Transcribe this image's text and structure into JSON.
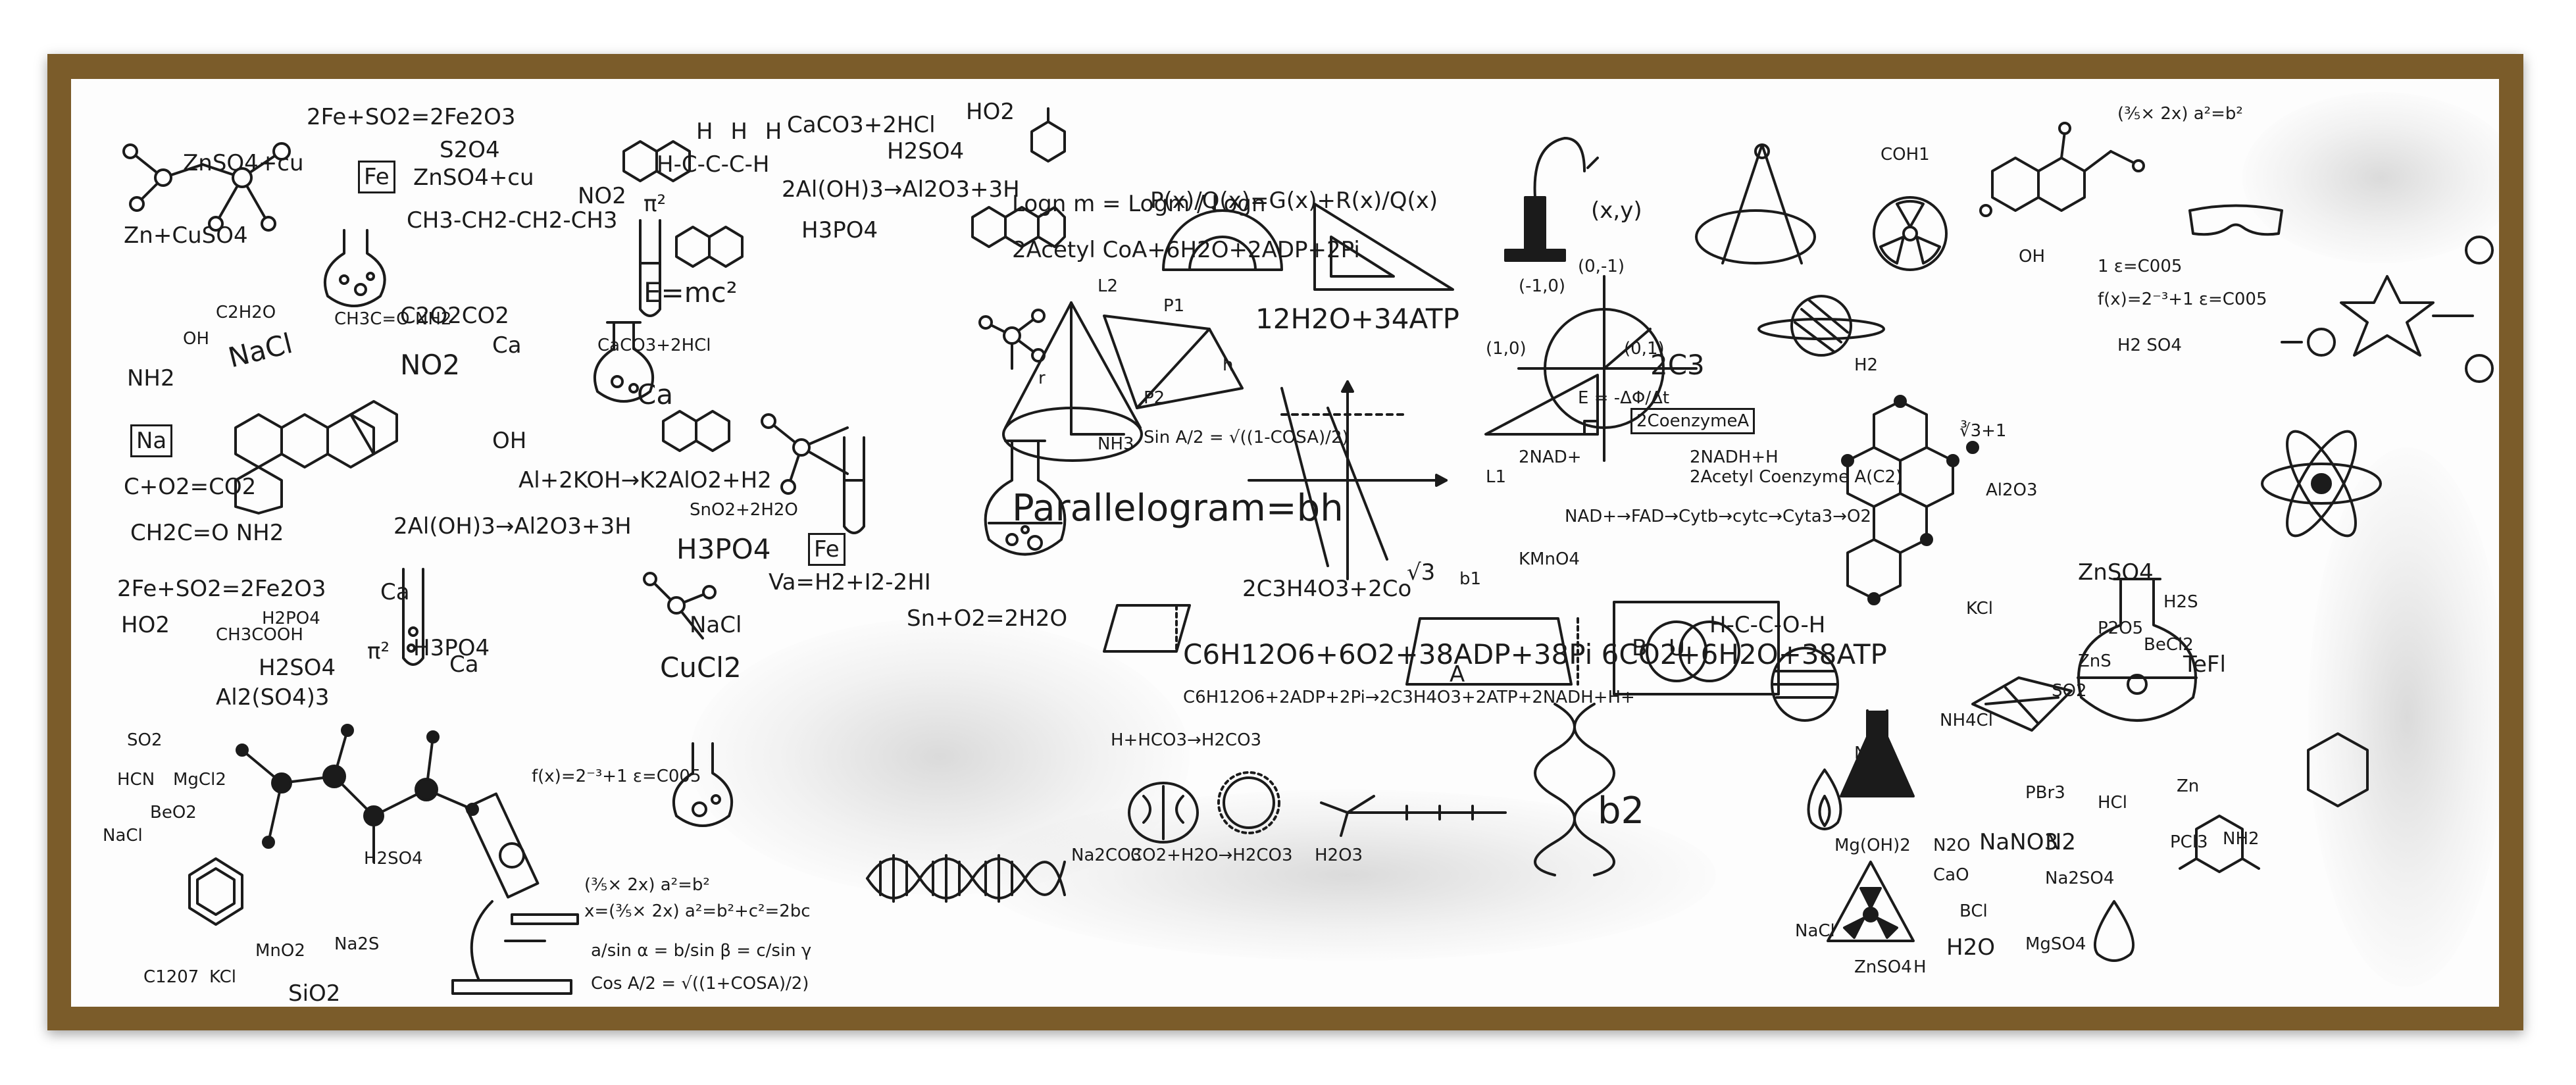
{
  "colors": {
    "frame": "#7b5c2a",
    "board": "#fdfdfd",
    "ink": "#1b1b1b"
  },
  "icons": [
    "molecule-icon",
    "flask-icon",
    "test-tube-icon",
    "microscope-icon",
    "dna-icon",
    "atom-icon",
    "radiation-icon",
    "brain-icon",
    "neuron-icon",
    "cone-icon",
    "protractor-icon",
    "set-square-icon",
    "compass-icon",
    "goggles-icon",
    "burner-icon",
    "fire-icon",
    "venn-diagram-icon",
    "planet-icon",
    "benzene-icon"
  ],
  "notes": [
    "ZnSO4+cu",
    "Zn+CuSO4",
    "2Fe+SO2=2Fe2O3",
    "S2O4",
    "Fe",
    "ZnSO4+cu",
    "NO2",
    "π²",
    "H H H",
    "H-C-C-C-H",
    "CaCO3+2HCl",
    "2Al(OH)3→Al2O3+3H",
    "H2SO4",
    "HO2",
    "H3PO4",
    "CH3-CH2-CH2-CH3",
    "E=mc²",
    "CH3C=O NH2",
    "C2H2O",
    "C2O2CO2",
    "NO2",
    "Ca",
    "OH",
    "NaCl",
    "NH2",
    "Na",
    "C+O2=CO2",
    "CH2C=O NH2",
    "CaCO3+2HCl",
    "Ca",
    "OH",
    "2Al(OH)3→Al2O3+3H",
    "Al+2KOH→K2AlO2+H2",
    "H3PO4",
    "Fe",
    "SnO2+2H2O",
    "Va=H2+I2-2HI",
    "Sn+O2=2H2O",
    "2Fe+SO2=2Fe2O3",
    "HO2",
    "CH3COOH",
    "H2PO4",
    "H2SO4",
    "Ca",
    "π²",
    "H3PO4",
    "Ca",
    "NaCl",
    "CuCl2",
    "Al2(SO4)3",
    "SO2",
    "HCN",
    "MgCl2",
    "BeO2",
    "NaCl",
    "C1207",
    "Na2S",
    "MnO2",
    "KCl",
    "SiO2",
    "H2SO4",
    "f(x)=2⁻³+1 ε=C005",
    "(⅗× 2x) a²=b²",
    "x=(⅗× 2x) a²=b²+c²=2bc",
    "a/sin α = b/sin β = c/sin γ",
    "Cos A/2 = √((1+COSA)/2)",
    "Logn m = Logm / Logn",
    "2Acetyl CoA+6H2O+2ADP+2Pi",
    "P(x)/Q(x)=G(x)+R(x)/Q(x)",
    "12H2O+34ATP",
    "Sin A/2 = √((1-COSA)/2)",
    "Parallelogram=bh",
    "2C3H4O3+2Co",
    "C6H12O6+6O2+38ADP+38Pi  6CO2+6H2O+38ATP",
    "C6H12O6+2ADP+2Pi→2C3H4O3+2ATP+2NADH+H+",
    "H+HCO3→H2CO3",
    "CO2+H2O→H2CO3",
    "H2O3",
    "Na2CO3",
    "(x,y)",
    "(-1,0)",
    "(1,0)",
    "(0,1)",
    "(0,-1)",
    "E = -ΔΦ/Δt",
    "2C3",
    "2CoenzymeA",
    "2NAD+",
    "2NADH+H",
    "2Acetyl Coenzyme A(C2)",
    "NAD+→FAD→Cytb→cytc→Cyta3→O2",
    "KMnO4",
    "b2",
    "b1",
    "A",
    "B",
    "U",
    "H-C-C-O-H",
    "√3",
    "L1",
    "L2",
    "P1",
    "P2",
    "h",
    "r",
    "NH3",
    "COH1",
    "OH",
    "(⅗× 2x) a²=b²",
    "1 ε=C005",
    "f(x)=2⁻³+1 ε=C005",
    "H2",
    "H2 SO4",
    "∛3+1",
    "Al2O3",
    "KCl",
    "ZnSO4",
    "H2S",
    "P2O5",
    "BeCl2",
    "ZnS",
    "TeFl",
    "SO2",
    "NH4Cl",
    "NCl3",
    "PBr3",
    "HCl",
    "Zn",
    "Mg(OH)2",
    "N2O",
    "CaO",
    "NaNO3",
    "N2",
    "Na2SO4",
    "BCl",
    "NaCl",
    "H2O",
    "MgSO4",
    "NH2",
    "PCl3",
    "ZnSO4",
    "H"
  ]
}
